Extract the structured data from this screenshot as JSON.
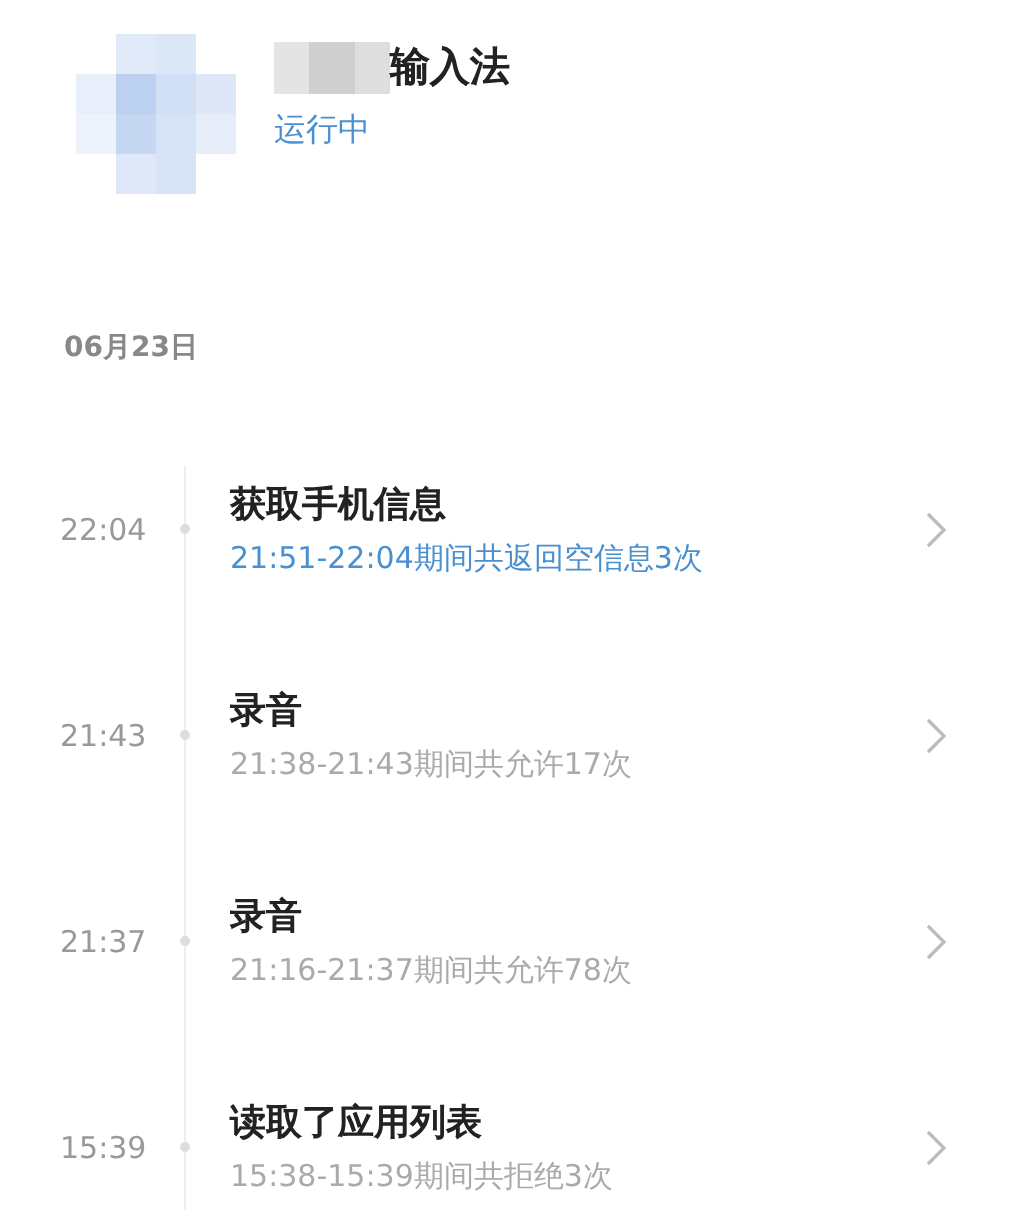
{
  "app": {
    "name_suffix": "输入法",
    "status": "运行中"
  },
  "date": "06月23日",
  "events": [
    {
      "time": "22:04",
      "title": "获取手机信息",
      "detail": "21:51-22:04期间共返回空信息3次",
      "highlight": true
    },
    {
      "time": "21:43",
      "title": "录音",
      "detail": "21:38-21:43期间共允许17次",
      "highlight": false
    },
    {
      "time": "21:37",
      "title": "录音",
      "detail": "21:16-21:37期间共允许78次",
      "highlight": false
    },
    {
      "time": "15:39",
      "title": "读取了应用列表",
      "detail": "15:38-15:39期间共拒绝3次",
      "highlight": false
    }
  ]
}
